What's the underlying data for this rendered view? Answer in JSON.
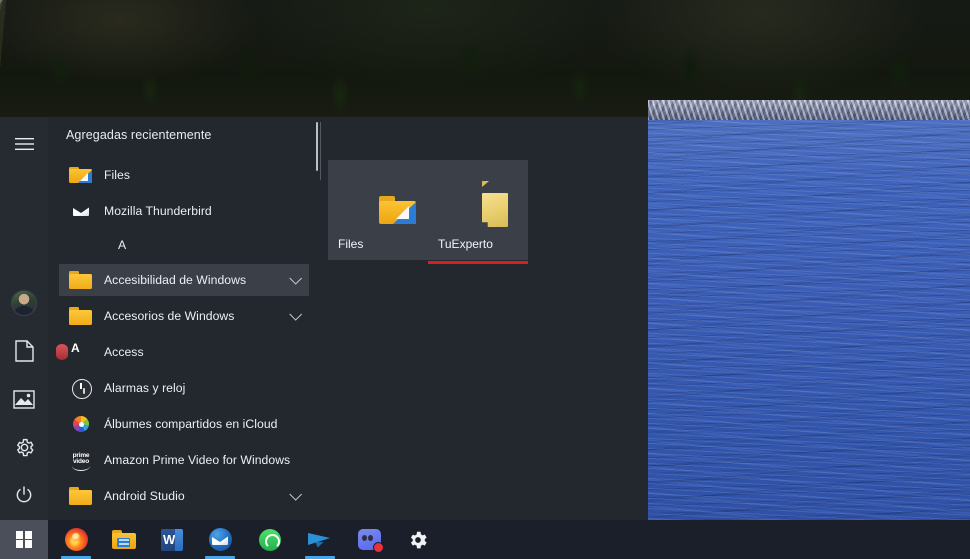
{
  "desktop": {
    "wallpaper_description": "rocky cliff with pine trees above a blue lake",
    "colors": {
      "start_menu_bg": "#23272e",
      "start_rail_bg": "#262a31",
      "tile_bg": "#3a3f48",
      "selection_bg": "#3b4048",
      "taskbar_bg": "#1b1f2a",
      "accent_blue": "#4aa4e8",
      "tile_underline_red": "#d81f26",
      "folder_yellow": "#fcc334"
    }
  },
  "start_menu": {
    "hamburger": {
      "name": "Menú",
      "icon": "hamburger-icon"
    },
    "rail_items": [
      {
        "id": "user",
        "label": "Cuenta de usuario",
        "icon": "avatar-icon"
      },
      {
        "id": "documents",
        "label": "Documentos",
        "icon": "document-icon"
      },
      {
        "id": "pictures",
        "label": "Imágenes",
        "icon": "picture-icon"
      },
      {
        "id": "settings",
        "label": "Configuración",
        "icon": "gear-icon"
      },
      {
        "id": "power",
        "label": "Inicio/Apagado",
        "icon": "power-icon"
      }
    ],
    "recent_header": "Agregadas recientemente",
    "recent_apps": [
      {
        "label": "Files",
        "icon": "files-app-icon",
        "has_chevron": false
      },
      {
        "label": "Mozilla Thunderbird",
        "icon": "thunderbird-icon",
        "has_chevron": false
      }
    ],
    "alpha_section": "A",
    "apps": [
      {
        "label": "Accesibilidad de Windows",
        "icon": "folder-icon",
        "has_chevron": true,
        "selected": true
      },
      {
        "label": "Accesorios de Windows",
        "icon": "folder-icon",
        "has_chevron": true,
        "selected": false
      },
      {
        "label": "Access",
        "icon": "access-icon",
        "has_chevron": false,
        "selected": false
      },
      {
        "label": "Alarmas y reloj",
        "icon": "clock-icon",
        "has_chevron": false,
        "selected": false
      },
      {
        "label": "Álbumes compartidos en iCloud",
        "icon": "icloud-photos-icon",
        "has_chevron": false,
        "selected": false
      },
      {
        "label": "Amazon Prime Video for Windows",
        "icon": "prime-video-icon",
        "has_chevron": false,
        "selected": false
      },
      {
        "label": "Android Studio",
        "icon": "folder-icon",
        "has_chevron": true,
        "selected": false
      }
    ],
    "prime_video_text": {
      "line1": "prime",
      "line2": "video"
    },
    "tiles": [
      {
        "label": "Files",
        "icon": "files-app-tile-icon",
        "underlined": false
      },
      {
        "label": "TuExperto",
        "icon": "folder-tile-icon",
        "underlined": true
      }
    ]
  },
  "taskbar": {
    "start_button": {
      "label": "Inicio",
      "icon": "windows-logo-icon"
    },
    "items": [
      {
        "label": "Mozilla Firefox",
        "icon": "firefox-icon",
        "running": true,
        "badge": false
      },
      {
        "label": "Explorador de archivos",
        "icon": "file-explorer-icon",
        "running": false,
        "badge": false
      },
      {
        "label": "Microsoft Word",
        "icon": "word-icon",
        "running": false,
        "badge": false
      },
      {
        "label": "Mozilla Thunderbird",
        "icon": "thunderbird-icon",
        "running": true,
        "badge": false
      },
      {
        "label": "WhatsApp",
        "icon": "whatsapp-icon",
        "running": true,
        "badge": false
      },
      {
        "label": "Telegram",
        "icon": "telegram-icon",
        "running": false,
        "badge": false
      },
      {
        "label": "Discord",
        "icon": "discord-icon",
        "running": false,
        "badge": true
      },
      {
        "label": "Configuración",
        "icon": "gear-icon",
        "running": false,
        "badge": false
      }
    ]
  }
}
